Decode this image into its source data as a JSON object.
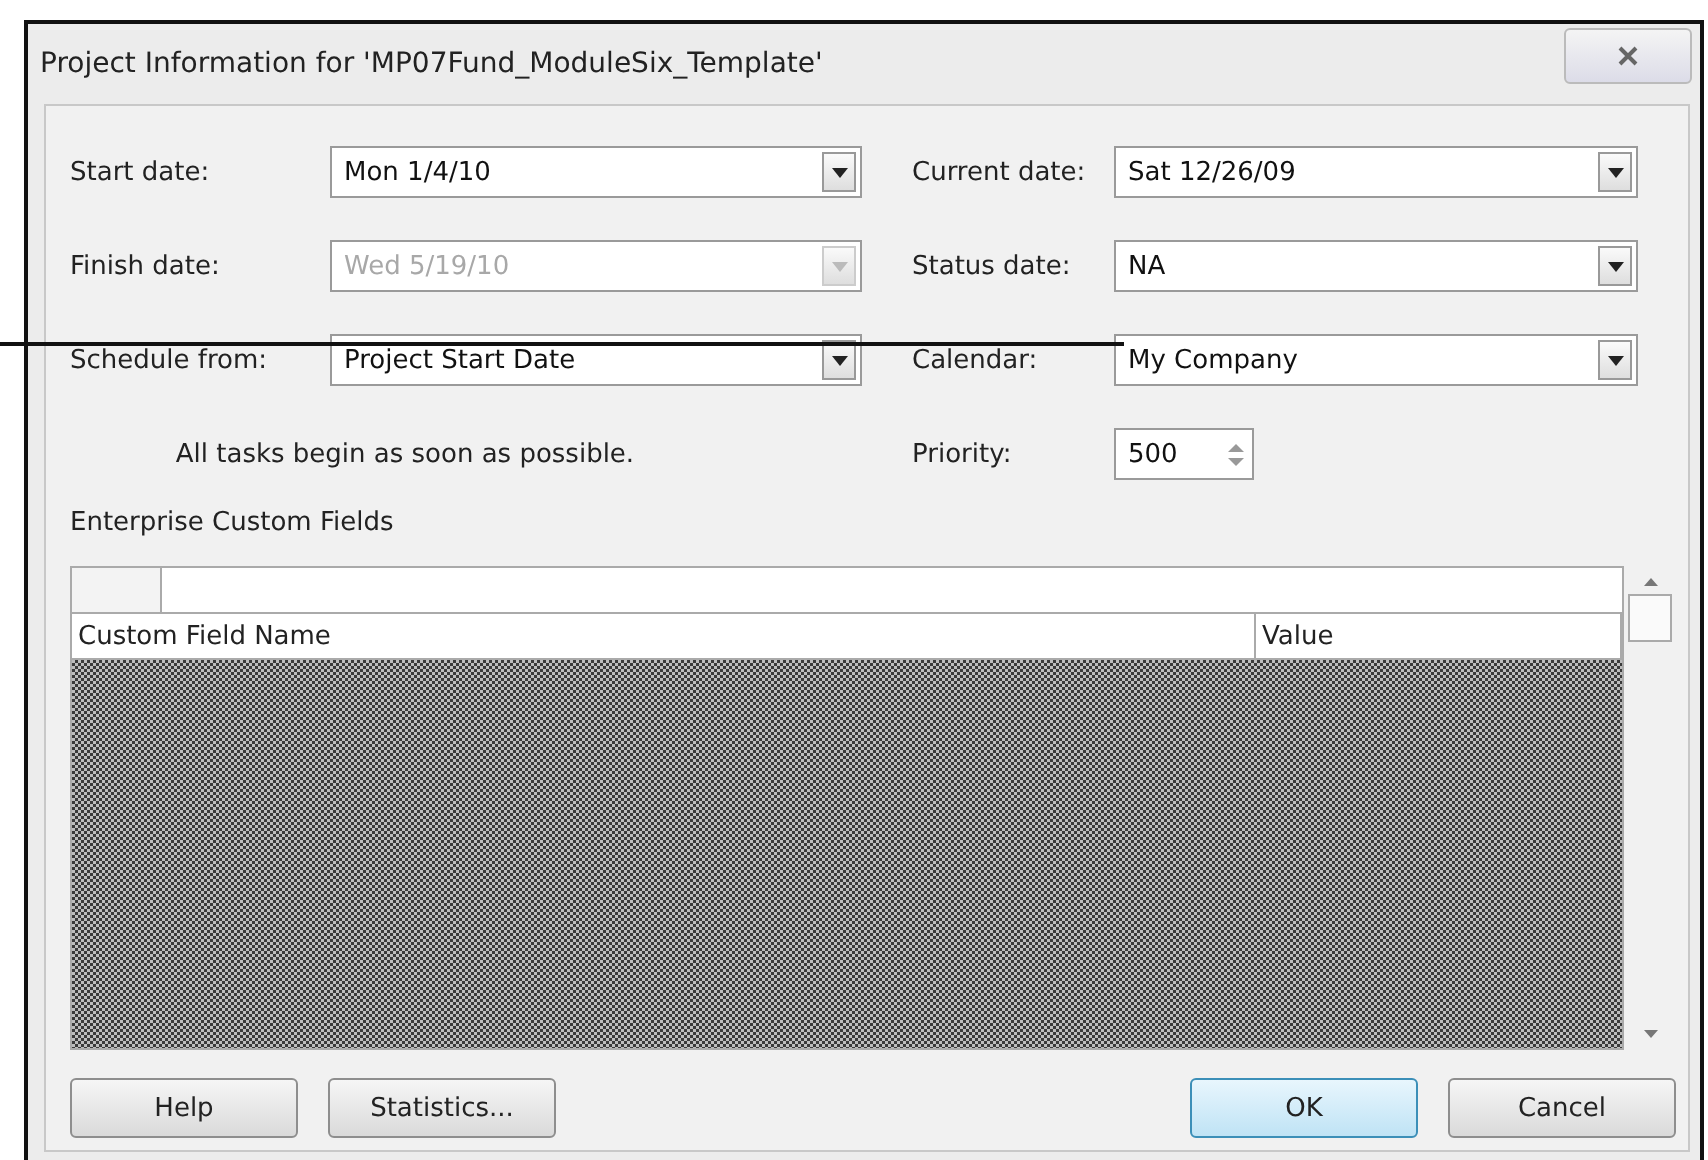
{
  "window": {
    "title": "Project Information for 'MP07Fund_ModuleSix_Template'"
  },
  "left_fields": [
    {
      "label": "Start date:",
      "value": "Mon 1/4/10",
      "kind": "dropdown",
      "disabled": false
    },
    {
      "label": "Finish date:",
      "value": "Wed 5/19/10",
      "kind": "dropdown",
      "disabled": true
    },
    {
      "label": "Schedule from:",
      "value": "Project Start Date",
      "kind": "dropdown",
      "disabled": false
    }
  ],
  "schedule_note": "All tasks begin as soon as possible.",
  "right_fields": [
    {
      "label": "Current date:",
      "value": "Sat 12/26/09",
      "kind": "dropdown",
      "disabled": false
    },
    {
      "label": "Status date:",
      "value": "NA",
      "kind": "dropdown",
      "disabled": false
    },
    {
      "label": "Calendar:",
      "value": "My Company",
      "kind": "dropdown",
      "disabled": false
    },
    {
      "label": "Priority:",
      "value": "500",
      "kind": "spinner",
      "disabled": false
    }
  ],
  "custom_fields": {
    "title": "Enterprise Custom Fields",
    "columns": [
      "Custom Field Name",
      "Value"
    ]
  },
  "buttons": [
    {
      "label": "Help",
      "default": false
    },
    {
      "label": "Statistics...",
      "default": false
    },
    {
      "label": "OK",
      "default": true
    },
    {
      "label": "Cancel",
      "default": false
    }
  ]
}
